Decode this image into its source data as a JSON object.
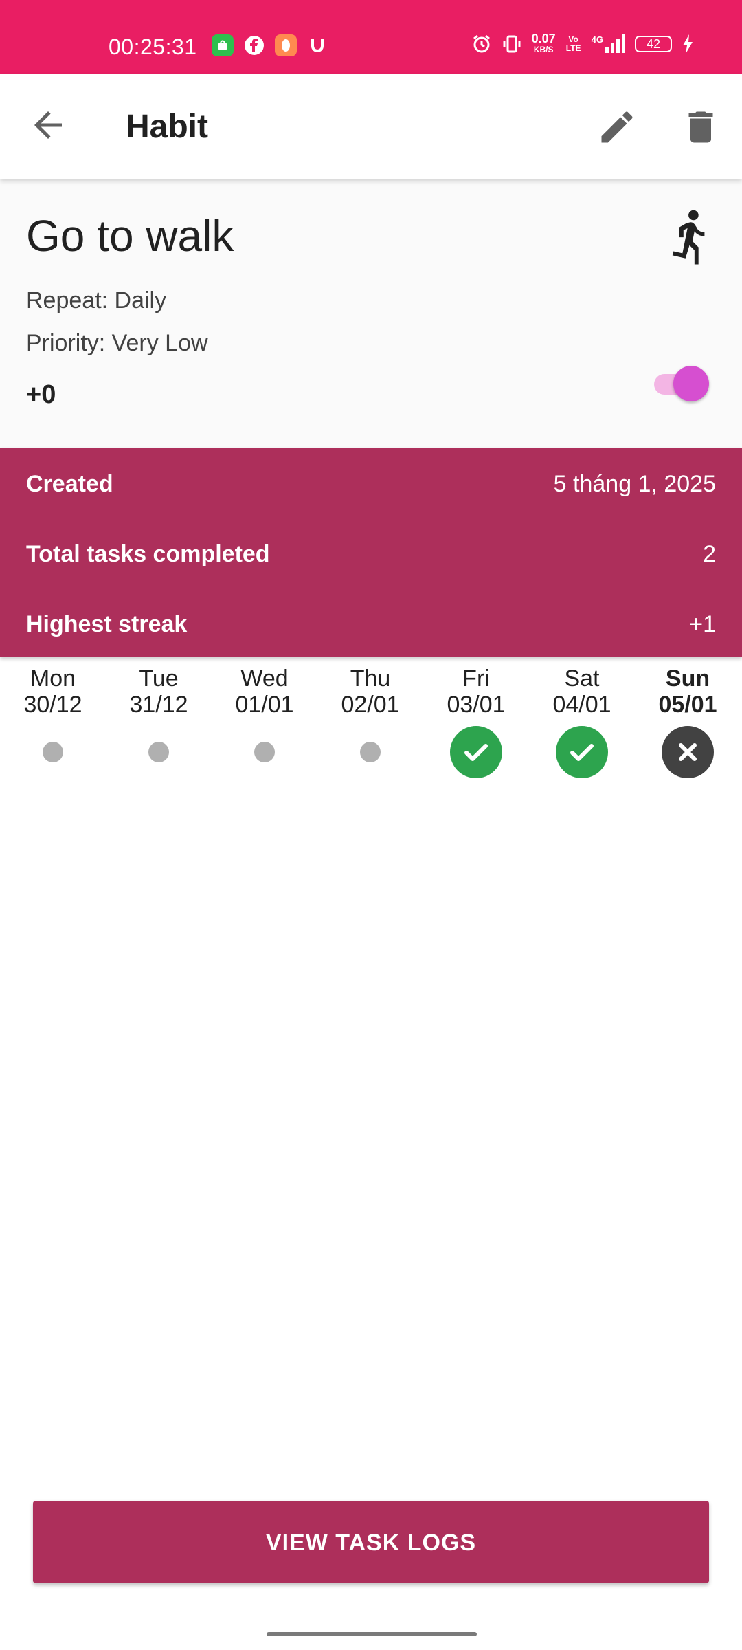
{
  "status_bar": {
    "time": "00:25:31",
    "network_speed": "0.07",
    "network_unit": "KB/S",
    "volte": "Vo LTE",
    "signal": "4G",
    "battery": "42",
    "background_color": "#e91e63"
  },
  "app_bar": {
    "title": "Habit",
    "back_icon": "arrow-back-icon",
    "edit_icon": "pencil-icon",
    "delete_icon": "trash-icon"
  },
  "habit": {
    "name": "Go to walk",
    "repeat": "Repeat: Daily",
    "priority": "Priority: Very Low",
    "score": "+0",
    "icon": "walking-person-icon",
    "toggle_on": true
  },
  "stats": {
    "background_color": "#ad2f5b",
    "rows": [
      {
        "label": "Created",
        "value": "5 tháng 1, 2025"
      },
      {
        "label": "Total tasks completed",
        "value": "2"
      },
      {
        "label": "Highest streak",
        "value": "+1"
      }
    ]
  },
  "week": [
    {
      "name": "Mon",
      "date": "30/12",
      "status": "none"
    },
    {
      "name": "Tue",
      "date": "31/12",
      "status": "none"
    },
    {
      "name": "Wed",
      "date": "01/01",
      "status": "none"
    },
    {
      "name": "Thu",
      "date": "02/01",
      "status": "none"
    },
    {
      "name": "Fri",
      "date": "03/01",
      "status": "done"
    },
    {
      "name": "Sat",
      "date": "04/01",
      "status": "done"
    },
    {
      "name": "Sun",
      "date": "05/01",
      "status": "missed",
      "today": true
    }
  ],
  "logs_button": {
    "label": "VIEW TASK LOGS"
  }
}
